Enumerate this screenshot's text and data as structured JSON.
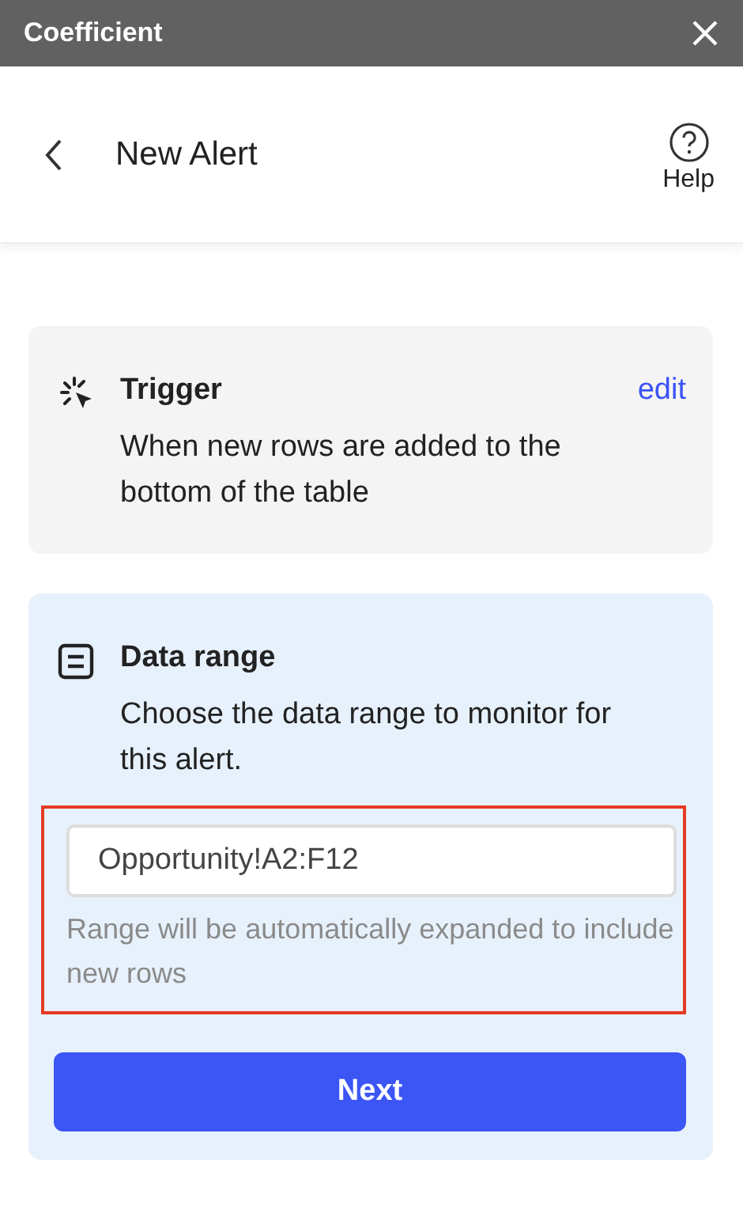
{
  "window": {
    "title": "Coefficient"
  },
  "header": {
    "title": "New Alert",
    "help_label": "Help"
  },
  "trigger": {
    "title": "Trigger",
    "action": "edit",
    "description": "When new rows are added to the bottom of the table",
    "active": false
  },
  "data_range": {
    "title": "Data range",
    "description": "Choose the data range to monitor for this alert.",
    "active": true,
    "field": {
      "value": "Opportunity!A2:F12",
      "highlighted": true
    },
    "hint": "Range will be automatically expanded to include new rows",
    "button": "Next"
  }
}
